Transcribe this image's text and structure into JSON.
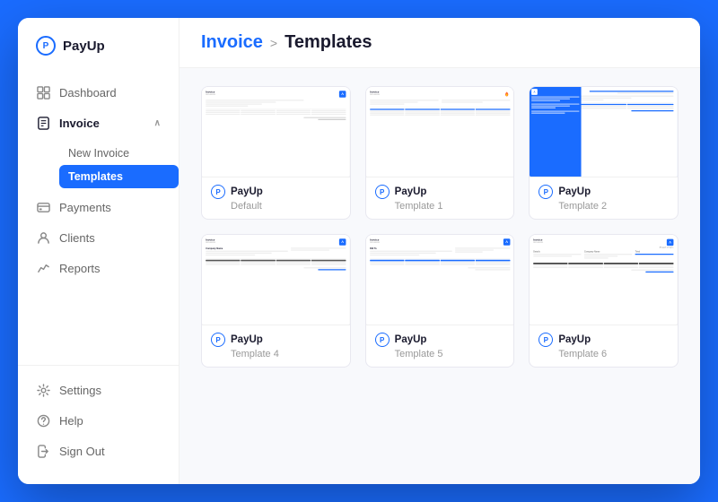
{
  "app": {
    "name": "PayUp",
    "logo_letter": "P"
  },
  "sidebar": {
    "collapse_icon": "‹",
    "items": [
      {
        "id": "dashboard",
        "label": "Dashboard",
        "icon": "grid-icon",
        "active": false
      },
      {
        "id": "invoice",
        "label": "Invoice",
        "icon": "invoice-icon",
        "active": true,
        "expanded": true
      },
      {
        "id": "payments",
        "label": "Payments",
        "icon": "payments-icon",
        "active": false
      },
      {
        "id": "clients",
        "label": "Clients",
        "icon": "clients-icon",
        "active": false
      },
      {
        "id": "reports",
        "label": "Reports",
        "icon": "reports-icon",
        "active": false
      }
    ],
    "invoice_sub": [
      {
        "id": "new-invoice",
        "label": "New Invoice",
        "active": false
      },
      {
        "id": "templates",
        "label": "Templates",
        "active": true
      }
    ],
    "bottom_items": [
      {
        "id": "settings",
        "label": "Settings",
        "icon": "gear-icon"
      },
      {
        "id": "help",
        "label": "Help",
        "icon": "help-icon"
      },
      {
        "id": "sign-out",
        "label": "Sign Out",
        "icon": "signout-icon"
      }
    ]
  },
  "header": {
    "breadcrumb_parent": "Invoice",
    "breadcrumb_sep": ">",
    "breadcrumb_current": "Templates"
  },
  "templates": [
    {
      "id": "default",
      "owner": "PayUp",
      "name": "Default",
      "style": "lines"
    },
    {
      "id": "template1",
      "owner": "PayUp",
      "name": "Template 1",
      "style": "colorlogo"
    },
    {
      "id": "template2",
      "owner": "PayUp",
      "name": "Template 2",
      "style": "bluesidebar"
    },
    {
      "id": "template4",
      "owner": "PayUp",
      "name": "Template 4",
      "style": "lines2"
    },
    {
      "id": "template5",
      "owner": "PayUp",
      "name": "Template 5",
      "style": "lines3"
    },
    {
      "id": "template6",
      "owner": "PayUp",
      "name": "Template 6",
      "style": "lines4"
    }
  ]
}
